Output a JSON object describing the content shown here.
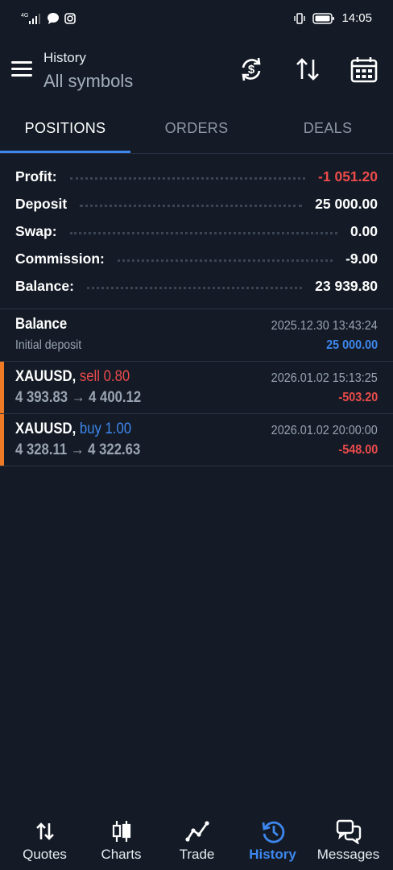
{
  "status_bar": {
    "time": "14:05",
    "network": "4G"
  },
  "header": {
    "subtitle": "History",
    "title": "All symbols",
    "icons": [
      "menu-icon",
      "sync-currency-icon",
      "sort-icon",
      "calendar-icon"
    ]
  },
  "tabs": [
    {
      "label": "POSITIONS",
      "active": true
    },
    {
      "label": "ORDERS",
      "active": false
    },
    {
      "label": "DEALS",
      "active": false
    }
  ],
  "summary": [
    {
      "label": "Profit:",
      "value": "-1 051.20",
      "negative": true
    },
    {
      "label": "Deposit",
      "value": "25 000.00",
      "negative": false
    },
    {
      "label": "Swap:",
      "value": "0.00",
      "negative": false
    },
    {
      "label": "Commission:",
      "value": "-9.00",
      "negative": false
    },
    {
      "label": "Balance:",
      "value": "23 939.80",
      "negative": false
    }
  ],
  "balance_entry": {
    "title": "Balance",
    "subtitle": "Initial deposit",
    "datetime": "2025.12.30 13:43:24",
    "amount": "25 000.00"
  },
  "deals": [
    {
      "symbol": "XAUUSD,",
      "side": "sell 0.80",
      "prices": "4 393.83 → 4 400.12",
      "datetime": "2026.01.02 15:13:25",
      "profit": "-503.20"
    },
    {
      "symbol": "XAUUSD,",
      "side": "buy 1.00",
      "prices": "4 328.11 → 4 322.63",
      "datetime": "2026.01.02 20:00:00",
      "profit": "-548.00"
    }
  ],
  "bottom_nav": [
    {
      "label": "Quotes",
      "icon": "quotes-icon",
      "active": false
    },
    {
      "label": "Charts",
      "icon": "charts-icon",
      "active": false
    },
    {
      "label": "Trade",
      "icon": "trade-icon",
      "active": false
    },
    {
      "label": "History",
      "icon": "history-icon",
      "active": true
    },
    {
      "label": "Messages",
      "icon": "messages-icon",
      "active": false
    }
  ],
  "colors": {
    "background": "#141b26",
    "accent": "#3d87ee",
    "loss": "#ec4b4b",
    "position_bar": "#f07a23"
  }
}
